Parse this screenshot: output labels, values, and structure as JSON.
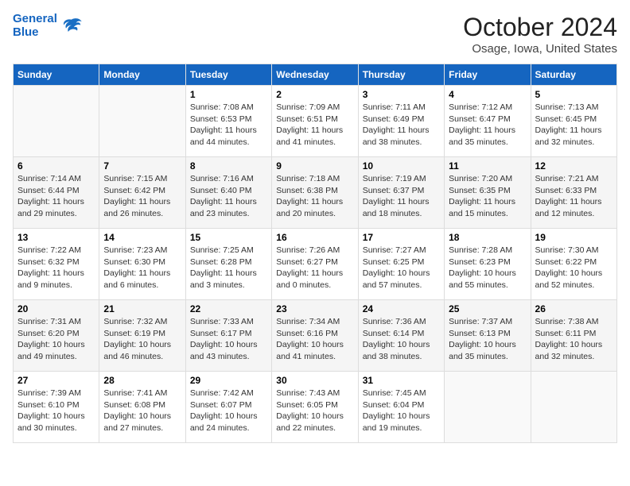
{
  "logo": {
    "line1": "General",
    "line2": "Blue"
  },
  "title": "October 2024",
  "location": "Osage, Iowa, United States",
  "days_header": [
    "Sunday",
    "Monday",
    "Tuesday",
    "Wednesday",
    "Thursday",
    "Friday",
    "Saturday"
  ],
  "weeks": [
    [
      {
        "day": "",
        "info": ""
      },
      {
        "day": "",
        "info": ""
      },
      {
        "day": "1",
        "info": "Sunrise: 7:08 AM\nSunset: 6:53 PM\nDaylight: 11 hours and 44 minutes."
      },
      {
        "day": "2",
        "info": "Sunrise: 7:09 AM\nSunset: 6:51 PM\nDaylight: 11 hours and 41 minutes."
      },
      {
        "day": "3",
        "info": "Sunrise: 7:11 AM\nSunset: 6:49 PM\nDaylight: 11 hours and 38 minutes."
      },
      {
        "day": "4",
        "info": "Sunrise: 7:12 AM\nSunset: 6:47 PM\nDaylight: 11 hours and 35 minutes."
      },
      {
        "day": "5",
        "info": "Sunrise: 7:13 AM\nSunset: 6:45 PM\nDaylight: 11 hours and 32 minutes."
      }
    ],
    [
      {
        "day": "6",
        "info": "Sunrise: 7:14 AM\nSunset: 6:44 PM\nDaylight: 11 hours and 29 minutes."
      },
      {
        "day": "7",
        "info": "Sunrise: 7:15 AM\nSunset: 6:42 PM\nDaylight: 11 hours and 26 minutes."
      },
      {
        "day": "8",
        "info": "Sunrise: 7:16 AM\nSunset: 6:40 PM\nDaylight: 11 hours and 23 minutes."
      },
      {
        "day": "9",
        "info": "Sunrise: 7:18 AM\nSunset: 6:38 PM\nDaylight: 11 hours and 20 minutes."
      },
      {
        "day": "10",
        "info": "Sunrise: 7:19 AM\nSunset: 6:37 PM\nDaylight: 11 hours and 18 minutes."
      },
      {
        "day": "11",
        "info": "Sunrise: 7:20 AM\nSunset: 6:35 PM\nDaylight: 11 hours and 15 minutes."
      },
      {
        "day": "12",
        "info": "Sunrise: 7:21 AM\nSunset: 6:33 PM\nDaylight: 11 hours and 12 minutes."
      }
    ],
    [
      {
        "day": "13",
        "info": "Sunrise: 7:22 AM\nSunset: 6:32 PM\nDaylight: 11 hours and 9 minutes."
      },
      {
        "day": "14",
        "info": "Sunrise: 7:23 AM\nSunset: 6:30 PM\nDaylight: 11 hours and 6 minutes."
      },
      {
        "day": "15",
        "info": "Sunrise: 7:25 AM\nSunset: 6:28 PM\nDaylight: 11 hours and 3 minutes."
      },
      {
        "day": "16",
        "info": "Sunrise: 7:26 AM\nSunset: 6:27 PM\nDaylight: 11 hours and 0 minutes."
      },
      {
        "day": "17",
        "info": "Sunrise: 7:27 AM\nSunset: 6:25 PM\nDaylight: 10 hours and 57 minutes."
      },
      {
        "day": "18",
        "info": "Sunrise: 7:28 AM\nSunset: 6:23 PM\nDaylight: 10 hours and 55 minutes."
      },
      {
        "day": "19",
        "info": "Sunrise: 7:30 AM\nSunset: 6:22 PM\nDaylight: 10 hours and 52 minutes."
      }
    ],
    [
      {
        "day": "20",
        "info": "Sunrise: 7:31 AM\nSunset: 6:20 PM\nDaylight: 10 hours and 49 minutes."
      },
      {
        "day": "21",
        "info": "Sunrise: 7:32 AM\nSunset: 6:19 PM\nDaylight: 10 hours and 46 minutes."
      },
      {
        "day": "22",
        "info": "Sunrise: 7:33 AM\nSunset: 6:17 PM\nDaylight: 10 hours and 43 minutes."
      },
      {
        "day": "23",
        "info": "Sunrise: 7:34 AM\nSunset: 6:16 PM\nDaylight: 10 hours and 41 minutes."
      },
      {
        "day": "24",
        "info": "Sunrise: 7:36 AM\nSunset: 6:14 PM\nDaylight: 10 hours and 38 minutes."
      },
      {
        "day": "25",
        "info": "Sunrise: 7:37 AM\nSunset: 6:13 PM\nDaylight: 10 hours and 35 minutes."
      },
      {
        "day": "26",
        "info": "Sunrise: 7:38 AM\nSunset: 6:11 PM\nDaylight: 10 hours and 32 minutes."
      }
    ],
    [
      {
        "day": "27",
        "info": "Sunrise: 7:39 AM\nSunset: 6:10 PM\nDaylight: 10 hours and 30 minutes."
      },
      {
        "day": "28",
        "info": "Sunrise: 7:41 AM\nSunset: 6:08 PM\nDaylight: 10 hours and 27 minutes."
      },
      {
        "day": "29",
        "info": "Sunrise: 7:42 AM\nSunset: 6:07 PM\nDaylight: 10 hours and 24 minutes."
      },
      {
        "day": "30",
        "info": "Sunrise: 7:43 AM\nSunset: 6:05 PM\nDaylight: 10 hours and 22 minutes."
      },
      {
        "day": "31",
        "info": "Sunrise: 7:45 AM\nSunset: 6:04 PM\nDaylight: 10 hours and 19 minutes."
      },
      {
        "day": "",
        "info": ""
      },
      {
        "day": "",
        "info": ""
      }
    ]
  ]
}
